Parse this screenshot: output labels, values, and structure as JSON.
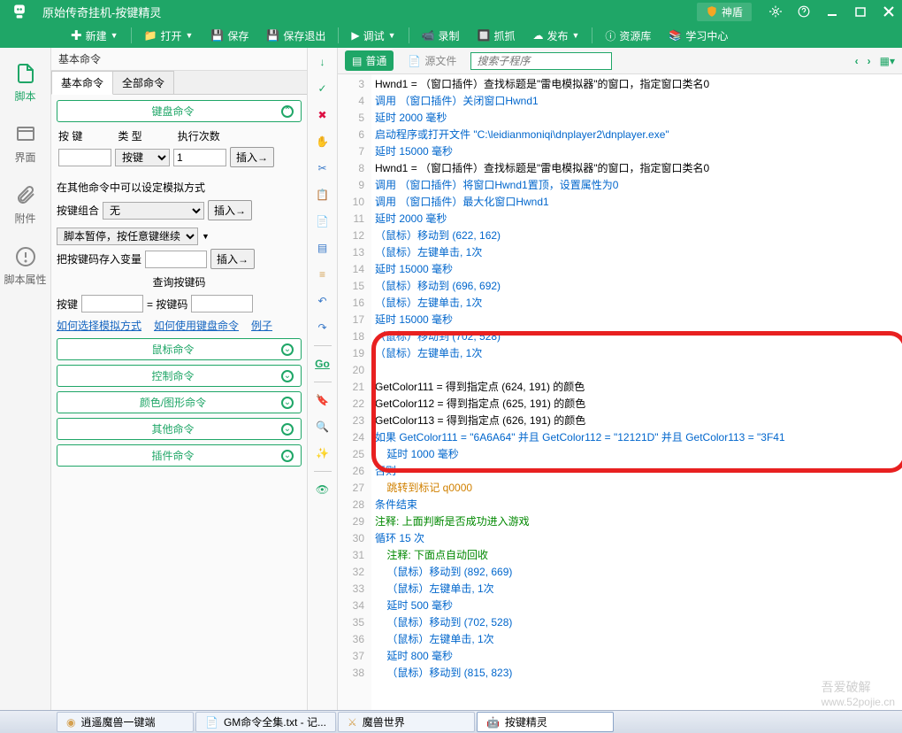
{
  "title": "原始传奇挂机-按键精灵",
  "shield": "神盾",
  "toolbar": {
    "new": "新建",
    "open": "打开",
    "save": "保存",
    "save_exit": "保存退出",
    "debug": "调试",
    "record": "录制",
    "grab": "抓抓",
    "publish": "发布",
    "resource": "资源库",
    "learn": "学习中心"
  },
  "rail": {
    "script": "脚本",
    "ui": "界面",
    "attach": "附件",
    "prop": "脚本属性"
  },
  "panel": {
    "hdr": "基本命令",
    "tab_basic": "基本命令",
    "tab_all": "全部命令",
    "kbd": "键盘命令",
    "mouse": "鼠标命令",
    "ctrl": "控制命令",
    "color": "颜色/图形命令",
    "other": "其他命令",
    "plugin": "插件命令",
    "key": "按 键",
    "type": "类 型",
    "type_val": "按键",
    "exec_count": "执行次数",
    "exec_val": "1",
    "insert": "插入→",
    "other_sim": "在其他命令中可以设定模拟方式",
    "combo": "按键组合",
    "combo_val": "无",
    "pause": "脚本暂停，按任意键继续",
    "store": "把按键码存入变量",
    "query": "查询按键码",
    "query_key": "按键",
    "query_eq": "= 按键码",
    "link1": "如何选择模拟方式",
    "link2": "如何使用键盘命令",
    "link3": "例子"
  },
  "edhead": {
    "mode1": "普通",
    "mode2": "源文件",
    "search_ph": "搜索子程序"
  },
  "code": [
    {
      "n": 3,
      "i": 0,
      "t": "Hwnd1 = （窗口插件）查找标题是\"雷电模拟器\"的窗口，指定窗口类名0",
      "c": "black"
    },
    {
      "n": 4,
      "i": 0,
      "t": "调用 （窗口插件）关闭窗口Hwnd1",
      "c": "blue"
    },
    {
      "n": 5,
      "i": 0,
      "t": "延时 2000 毫秒",
      "c": "blue"
    },
    {
      "n": 6,
      "i": 0,
      "t": "启动程序或打开文件 \"C:\\leidianmoniqi\\dnplayer2\\dnplayer.exe\"",
      "c": "blue"
    },
    {
      "n": 7,
      "i": 0,
      "t": "延时 15000 毫秒",
      "c": "blue"
    },
    {
      "n": 8,
      "i": 0,
      "t": "Hwnd1 = （窗口插件）查找标题是\"雷电模拟器\"的窗口，指定窗口类名0",
      "c": "black"
    },
    {
      "n": 9,
      "i": 0,
      "t": "调用 （窗口插件）将窗口Hwnd1置顶，设置属性为0",
      "c": "blue"
    },
    {
      "n": 10,
      "i": 0,
      "t": "调用 （窗口插件）最大化窗口Hwnd1",
      "c": "blue"
    },
    {
      "n": 11,
      "i": 0,
      "t": "延时 2000 毫秒",
      "c": "blue"
    },
    {
      "n": 12,
      "i": 0,
      "t": "（鼠标）移动到 (622, 162)",
      "c": "blue"
    },
    {
      "n": 13,
      "i": 0,
      "t": "（鼠标）左键单击, 1次",
      "c": "blue"
    },
    {
      "n": 14,
      "i": 0,
      "t": "延时 15000 毫秒",
      "c": "blue"
    },
    {
      "n": 15,
      "i": 0,
      "t": "（鼠标）移动到 (696, 692)",
      "c": "blue"
    },
    {
      "n": 16,
      "i": 0,
      "t": "（鼠标）左键单击, 1次",
      "c": "blue"
    },
    {
      "n": 17,
      "i": 0,
      "t": "延时 15000 毫秒",
      "c": "blue"
    },
    {
      "n": 18,
      "i": 0,
      "t": "（鼠标）移动到 (702, 528)",
      "c": "blue"
    },
    {
      "n": 19,
      "i": 0,
      "t": "（鼠标）左键单击, 1次",
      "c": "blue"
    },
    {
      "n": 20,
      "i": 0,
      "t": "",
      "c": "blue"
    },
    {
      "n": 21,
      "i": 0,
      "t": "GetColor111 = 得到指定点 (624, 191) 的颜色",
      "c": "black"
    },
    {
      "n": 22,
      "i": 0,
      "t": "GetColor112 = 得到指定点 (625, 191) 的颜色",
      "c": "black"
    },
    {
      "n": 23,
      "i": 0,
      "t": "GetColor113 = 得到指定点 (626, 191) 的颜色",
      "c": "black"
    },
    {
      "n": 24,
      "i": 0,
      "t": "如果 GetColor111 = \"6A6A64\" 并且 GetColor112 = \"12121D\" 并且 GetColor113 = \"3F41",
      "c": "blue"
    },
    {
      "n": 25,
      "i": 1,
      "t": "延时 1000 毫秒",
      "c": "blue"
    },
    {
      "n": 26,
      "i": 0,
      "t": "否则",
      "c": "blue"
    },
    {
      "n": 27,
      "i": 1,
      "t": "跳转到标记 q0000",
      "c": "orange"
    },
    {
      "n": 28,
      "i": 0,
      "t": "条件结束",
      "c": "blue"
    },
    {
      "n": 29,
      "i": 0,
      "t": "注释: 上面判断是否成功进入游戏",
      "c": "green"
    },
    {
      "n": 30,
      "i": 0,
      "t": "循环 15 次",
      "c": "blue"
    },
    {
      "n": 31,
      "i": 1,
      "t": "注释: 下面点自动回收",
      "c": "green"
    },
    {
      "n": 32,
      "i": 1,
      "t": "（鼠标）移动到 (892, 669)",
      "c": "blue"
    },
    {
      "n": 33,
      "i": 1,
      "t": "（鼠标）左键单击, 1次",
      "c": "blue"
    },
    {
      "n": 34,
      "i": 1,
      "t": "延时 500 毫秒",
      "c": "blue"
    },
    {
      "n": 35,
      "i": 1,
      "t": "（鼠标）移动到 (702, 528)",
      "c": "blue"
    },
    {
      "n": 36,
      "i": 1,
      "t": "（鼠标）左键单击, 1次",
      "c": "blue"
    },
    {
      "n": 37,
      "i": 1,
      "t": "延时 800 毫秒",
      "c": "blue"
    },
    {
      "n": 38,
      "i": 1,
      "t": "（鼠标）移动到 (815, 823)",
      "c": "blue"
    }
  ],
  "tasks": {
    "t1": "逍遥魔兽一键端",
    "t2": "GM命令全集.txt - 记...",
    "t3": "魔兽世界",
    "t4": "按键精灵"
  },
  "watermark": {
    "cn": "吾爱破解",
    "en": "www.52pojie.cn"
  }
}
